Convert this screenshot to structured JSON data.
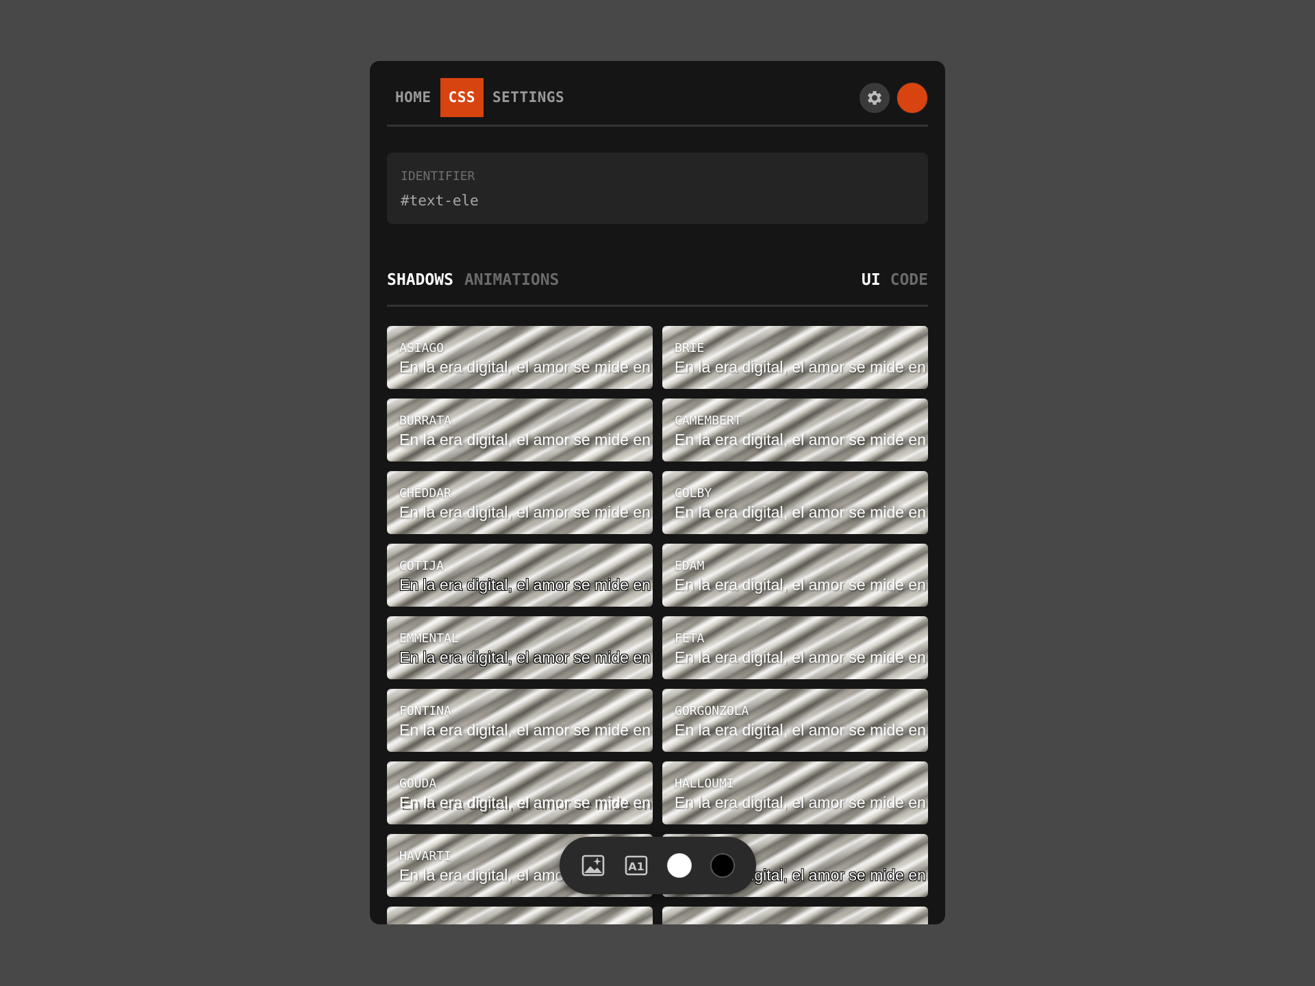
{
  "colors": {
    "accent": "#d84410",
    "panel": "#151515",
    "background": "#484848"
  },
  "nav": {
    "tabs": [
      {
        "label": "HOME",
        "active": false
      },
      {
        "label": "CSS",
        "active": true
      },
      {
        "label": "SETTINGS",
        "active": false
      }
    ],
    "icons": {
      "settings": "gear-icon",
      "profile": "avatar"
    }
  },
  "identifier": {
    "label": "IDENTIFIER",
    "value": "#text-ele"
  },
  "subnav": {
    "left": [
      {
        "label": "SHADOWS",
        "active": true
      },
      {
        "label": "ANIMATIONS",
        "active": false
      }
    ],
    "right": [
      {
        "label": "UI",
        "active": true
      },
      {
        "label": "CODE",
        "active": false
      }
    ]
  },
  "sample_text": "En la era digital, el amor se mide en",
  "cards": [
    {
      "name": "ASIAGO"
    },
    {
      "name": "BRIE"
    },
    {
      "name": "BURRATA"
    },
    {
      "name": "CAMEMBERT"
    },
    {
      "name": "CHEDDAR"
    },
    {
      "name": "COLBY"
    },
    {
      "name": "COTIJA"
    },
    {
      "name": "EDAM"
    },
    {
      "name": "EMMENTAL"
    },
    {
      "name": "FETA"
    },
    {
      "name": "FONTINA"
    },
    {
      "name": "GORGONZOLA"
    },
    {
      "name": "GOUDA"
    },
    {
      "name": "HALLOUMI"
    },
    {
      "name": "HAVARTI"
    },
    {
      "name": ""
    }
  ],
  "toolbar": {
    "items": [
      "image-sparkle-icon",
      "font-a1-icon",
      "white-swatch",
      "black-swatch"
    ],
    "swatches": {
      "white": "#ffffff",
      "black": "#000000"
    }
  }
}
